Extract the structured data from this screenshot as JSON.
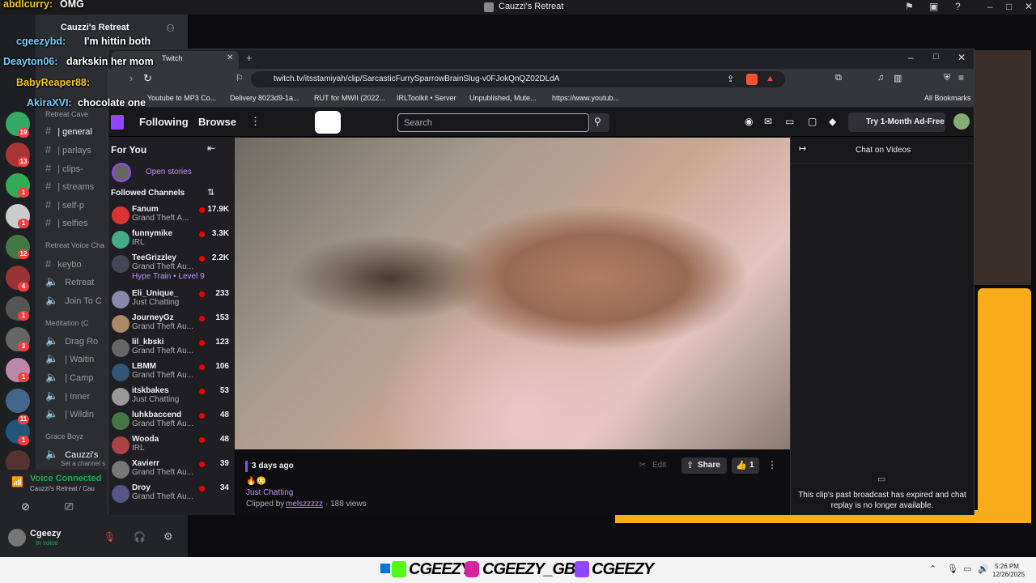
{
  "outer_window": {
    "title": "Cauzzi's Retreat"
  },
  "chat_overlay": [
    {
      "user": "abdlcurry:",
      "msg": "OMG"
    },
    {
      "user": "cgeezybd:",
      "msg": "I'm hittin both"
    },
    {
      "user": "Deayton06:",
      "msg": "darkskin her mom"
    },
    {
      "user": "BabyReaper88:",
      "msg": ""
    },
    {
      "user": "AkiraXVI:",
      "msg": "chocolate one"
    }
  ],
  "discord": {
    "server_name": "Cauzzi's Retreat",
    "category1": "Retreat Cave",
    "channels1": [
      "| general",
      "| parlays",
      "| clips-",
      "| streams",
      "| self-p",
      "| selfies"
    ],
    "category2": "Retreat Voice Cha",
    "voice_channels": [
      "keybo",
      "Retreat",
      "Join To C"
    ],
    "category3": "Meditation (C",
    "meditation_channels": [
      "Drag Ro",
      "| Waitin",
      "| Camp",
      "| Inner",
      "| Wildin"
    ],
    "category4": "Grace Boyz",
    "active_channel": "Cauzzi's",
    "active_sub": "Set a channel s",
    "voice_connected": "Voice Connected",
    "voice_location": "Cauzzi's Retreat / Cau",
    "username": "Cgeezy",
    "user_status": "In voice",
    "server_badges": [
      "19",
      "13",
      "1",
      "1",
      "12",
      "4",
      "1",
      "3",
      "1",
      "11",
      "1"
    ]
  },
  "browser": {
    "tab_title": "Twitch",
    "url": "twitch.tv/itsstamiyah/clip/SarcasticFurrySparrowBrainSlug-v0FJokQnQZ02DLdA",
    "bookmarks": [
      "Youtube to MP3 Co...",
      "Delivery 8023d9-1a...",
      "RUT for MWII (2022...",
      "IRLToolkit • Server",
      "Unpublished, Mute...",
      "https://www.youtub..."
    ],
    "all_bookmarks": "All Bookmarks"
  },
  "twitch": {
    "nav": {
      "following": "Following",
      "browse": "Browse",
      "search_placeholder": "Search",
      "ad_free": "Try 1-Month Ad-Free"
    },
    "sidebar": {
      "for_you": "For You",
      "open_stories": "Open stories",
      "followed": "Followed Channels",
      "channels": [
        {
          "name": "Fanum",
          "game": "Grand Theft A...",
          "viewers": "17.9K"
        },
        {
          "name": "funnymike",
          "game": "IRL",
          "viewers": "3.3K"
        },
        {
          "name": "TeeGrizzley",
          "game": "Grand Theft Au...",
          "viewers": "2.2K",
          "extra": "Hype Train • Level 9"
        },
        {
          "name": "Eli_Unique_",
          "game": "Just Chatting",
          "viewers": "233"
        },
        {
          "name": "JourneyGz",
          "game": "Grand Theft Au...",
          "viewers": "153"
        },
        {
          "name": "lil_kbski",
          "game": "Grand Theft Au...",
          "viewers": "123"
        },
        {
          "name": "LBMM",
          "game": "Grand Theft Au...",
          "viewers": "106"
        },
        {
          "name": "itskbakes",
          "game": "Just Chatting",
          "viewers": "53"
        },
        {
          "name": "luhkbaccend",
          "game": "Grand Theft Au...",
          "viewers": "48"
        },
        {
          "name": "Wooda",
          "game": "IRL",
          "viewers": "48"
        },
        {
          "name": "Xavierr",
          "game": "Grand Theft Au...",
          "viewers": "39"
        },
        {
          "name": "Droy",
          "game": "Grand Theft Au...",
          "viewers": "34"
        }
      ]
    },
    "clip": {
      "age": "3 days ago",
      "category": "Just Chatting",
      "clipped_by_label": "Clipped by",
      "clipper": "melszzzzz",
      "views": "· 188 views",
      "edit": "Edit",
      "share": "Share",
      "likes": "1"
    },
    "chat": {
      "title": "Chat on Videos",
      "message": "This clip's past broadcast has expired and chat replay is no longer available."
    }
  },
  "taskbar": {
    "handle1": "CGEEZY",
    "handle2": "CGEEZY_GBC",
    "handle3": "CGEEZY",
    "time": "5:26 PM",
    "date": "12/26/2025"
  }
}
